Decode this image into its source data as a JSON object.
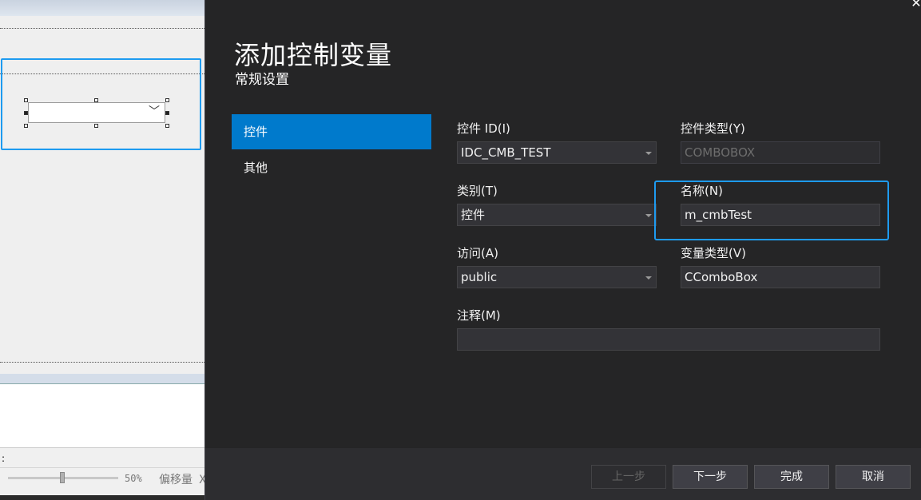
{
  "designer": {
    "status_colon": ":",
    "zoom_label": "50%",
    "offset_label": "偏移量 X"
  },
  "dialog": {
    "title": "添加控制变量",
    "subtitle": "常规设置",
    "close_glyph": "✕",
    "nav": [
      {
        "label": "控件",
        "active": true
      },
      {
        "label": "其他",
        "active": false
      }
    ],
    "fields": {
      "control_id": {
        "label": "控件 ID(I)",
        "value": "IDC_CMB_TEST"
      },
      "control_type": {
        "label": "控件类型(Y)",
        "value": "COMBOBOX"
      },
      "category": {
        "label": "类别(T)",
        "value": "控件"
      },
      "name": {
        "label": "名称(N)",
        "value": "m_cmbTest"
      },
      "access": {
        "label": "访问(A)",
        "value": "public"
      },
      "var_type": {
        "label": "变量类型(V)",
        "value": "CComboBox"
      },
      "comment": {
        "label": "注释(M)",
        "value": ""
      }
    },
    "buttons": {
      "prev": "上一步",
      "next": "下一步",
      "finish": "完成",
      "cancel": "取消"
    }
  },
  "colors": {
    "accent": "#007acc",
    "highlight_border": "#1e9bf0",
    "dialog_bg": "#252526",
    "field_bg": "#333337"
  }
}
